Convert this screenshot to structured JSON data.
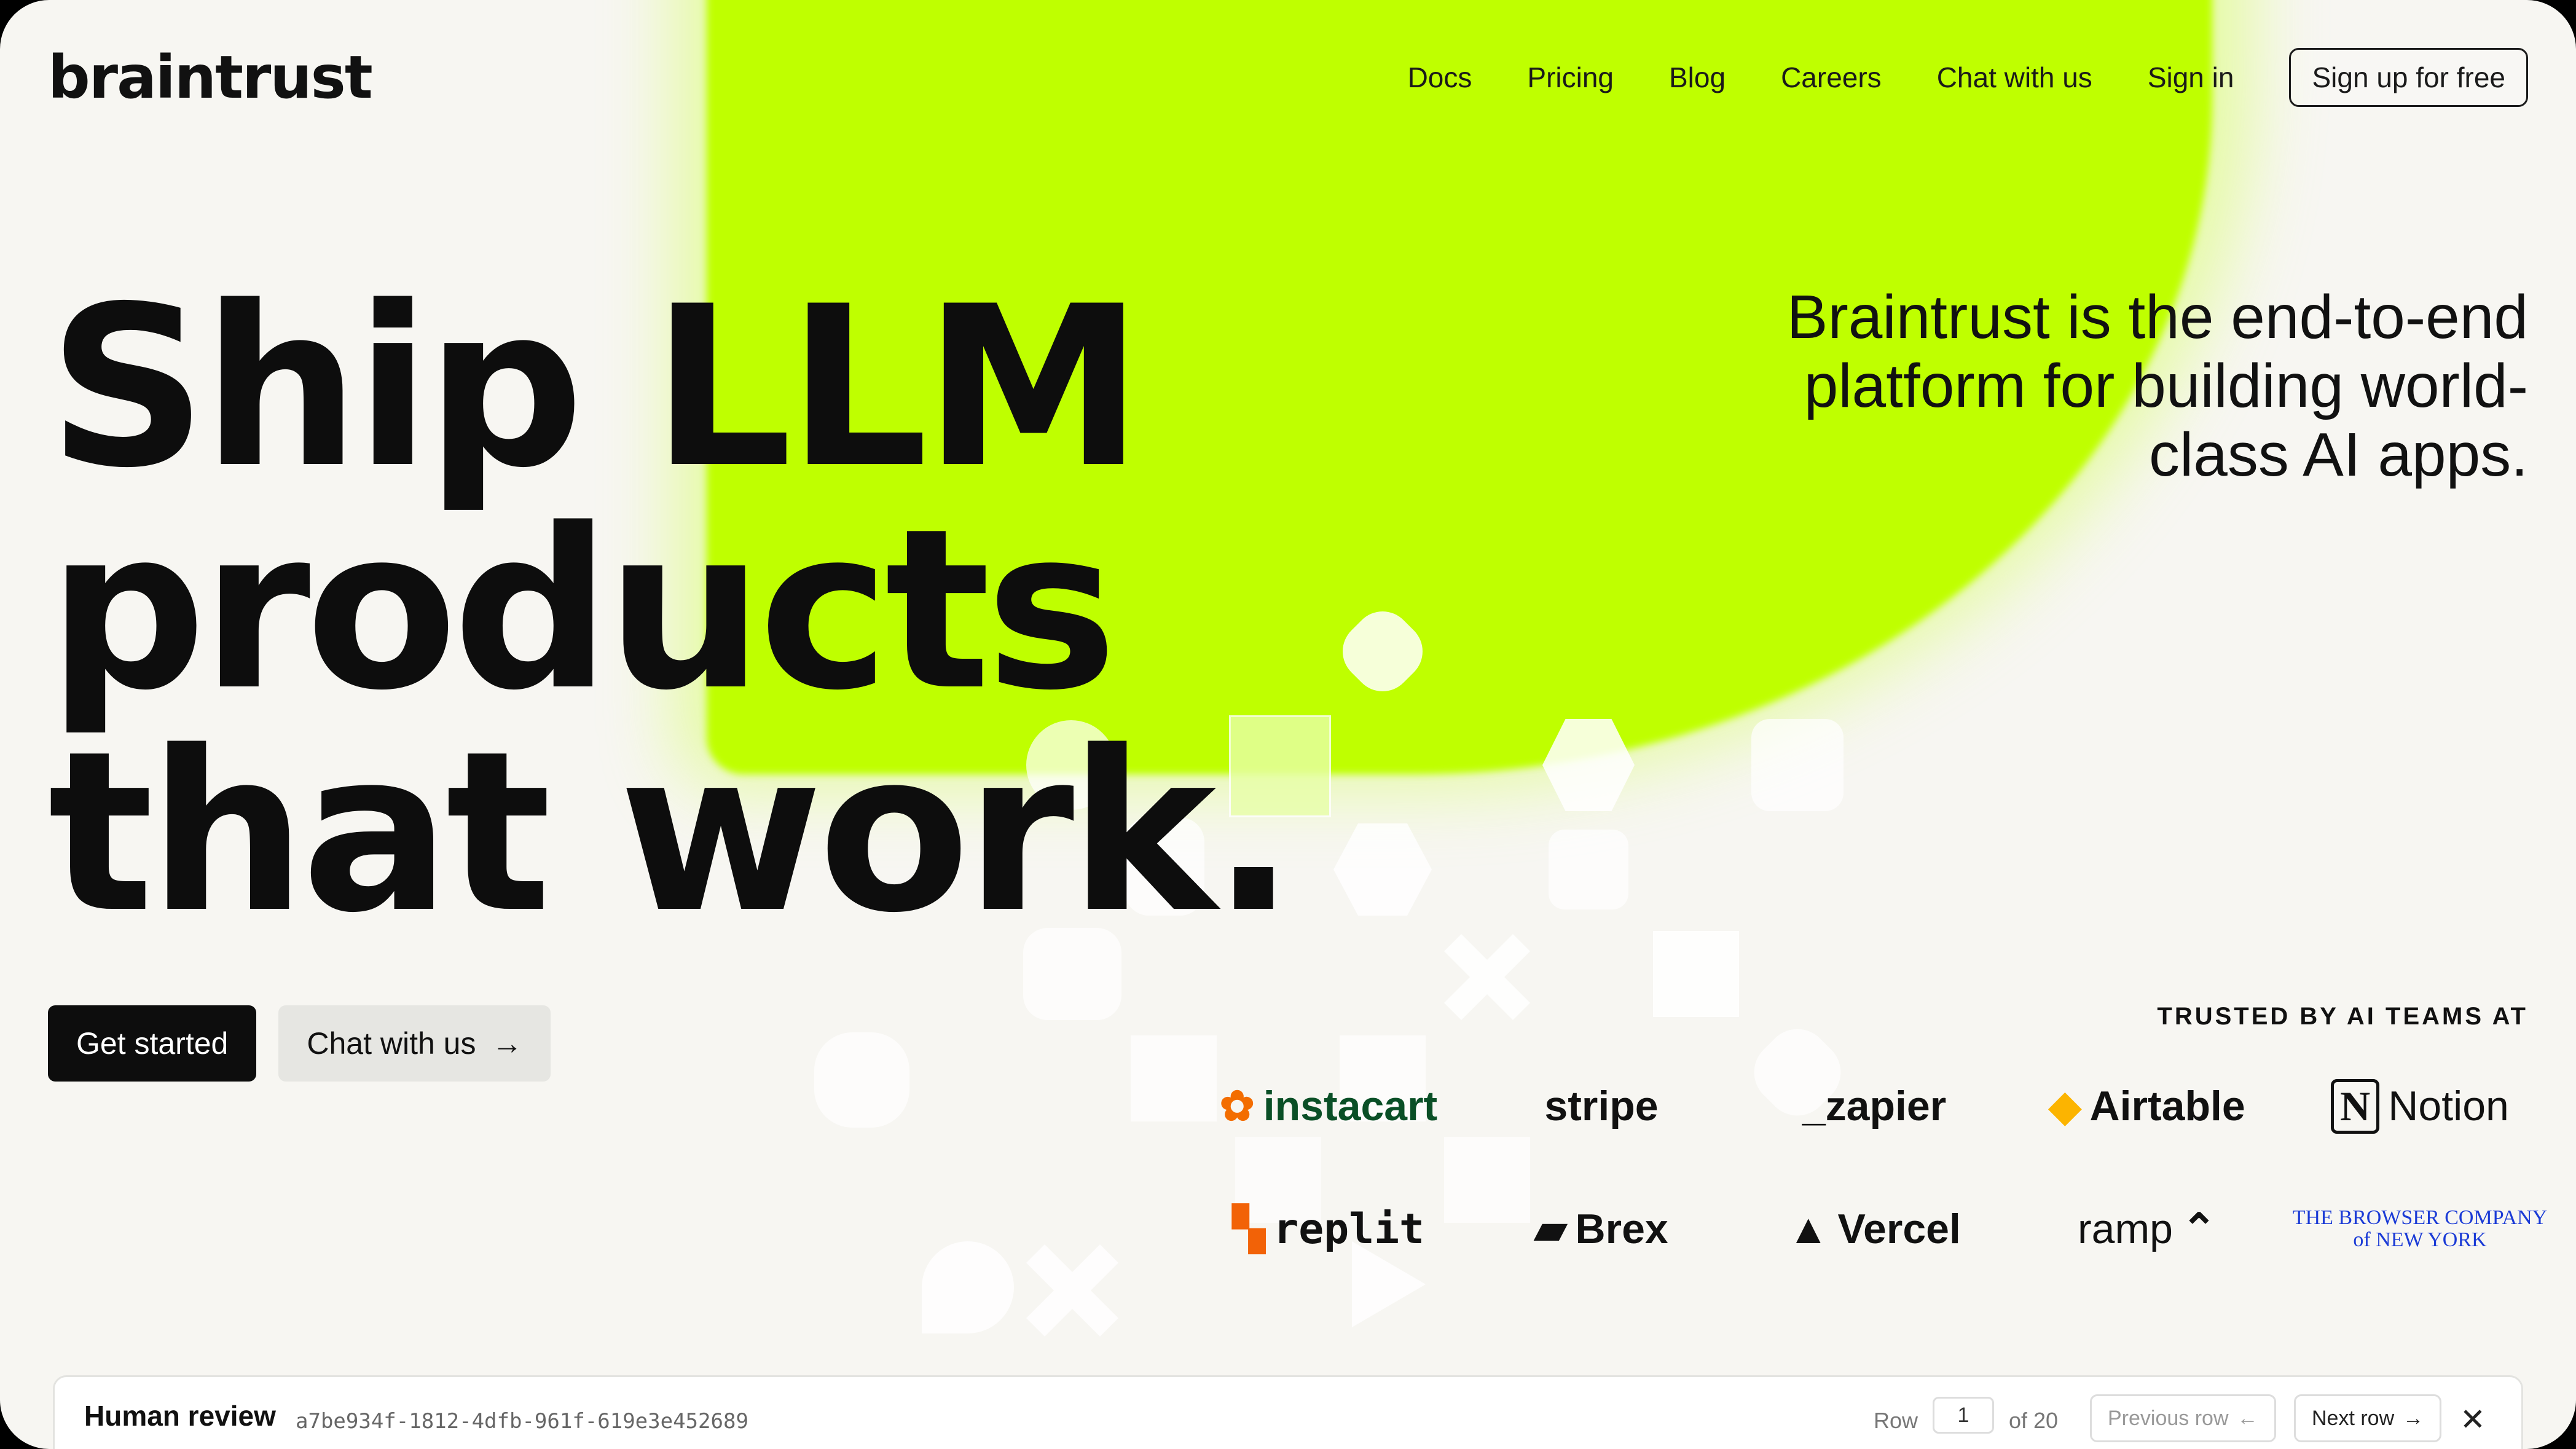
{
  "nav": {
    "logo": "braintrust",
    "links": [
      "Docs",
      "Pricing",
      "Blog",
      "Careers",
      "Chat with us",
      "Sign in"
    ],
    "signup": "Sign up for free"
  },
  "hero": {
    "lines": [
      "Ship LLM",
      "products",
      "that work."
    ],
    "tagline": "Braintrust is the end-to-end platform for building world-class AI apps."
  },
  "cta": {
    "primary": "Get started",
    "secondary": "Chat with us",
    "secondary_icon": "arrow-right-icon"
  },
  "trusted": {
    "heading": "TRUSTED BY AI TEAMS AT",
    "logos": [
      "instacart",
      "stripe",
      "_zapier",
      "Airtable",
      "Notion",
      "replit",
      "Brex",
      "Vercel",
      "ramp",
      "THE BROWSER COMPANY of NEW YORK"
    ]
  },
  "review": {
    "title": "Human review",
    "id": "a7be934f-1812-4dfb-961f-619e3e452689",
    "row_label": "Row",
    "row_value": "1",
    "row_of": "of 20",
    "prev": "Previous row",
    "next": "Next row",
    "close_icon": "close-icon"
  },
  "colors": {
    "accent": "#bfff00",
    "background": "#f7f6f2",
    "text": "#0d0d0d"
  }
}
